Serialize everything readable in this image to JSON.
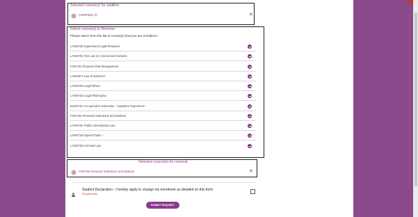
{
  "addition": {
    "legend": "Selected course(s) for addition",
    "course": "COMP5001 (f)"
  },
  "remove": {
    "legend": "Select course(s) to Remove",
    "instruction": "Please select from the list of course(s) that you are enrolled in",
    "courses": [
      "LAWS736 Supervised Legal Research",
      "LAWS7Ek Tort Law in Commercial Contexts",
      "FINA702 Financial Risk Management",
      "LAWS574 Law of Evidence",
      "LAWS706 Legal Ethics",
      "LAWS728 Legal Philosophy",
      "BUSS701 Co-operative Education - Capstone Experience",
      "FINA706 Financial Institutions and Markets",
      "LAWS70n Public International Law",
      "LAWS738 Special Topic I",
      "LAWS798 Criminal Law"
    ]
  },
  "removal": {
    "legend": "Selected course(s) for removal",
    "course": "FINA706 Financial Institutions and Markets"
  },
  "declaration": {
    "text": "Student Declaration - I hereby apply to change my enrolment as detailed on this form.",
    "required": "Required field"
  },
  "submit_label": "SUBMIT REQUEST",
  "colors": {
    "accent": "#8b3a8d",
    "background": "#8a4a8c"
  }
}
